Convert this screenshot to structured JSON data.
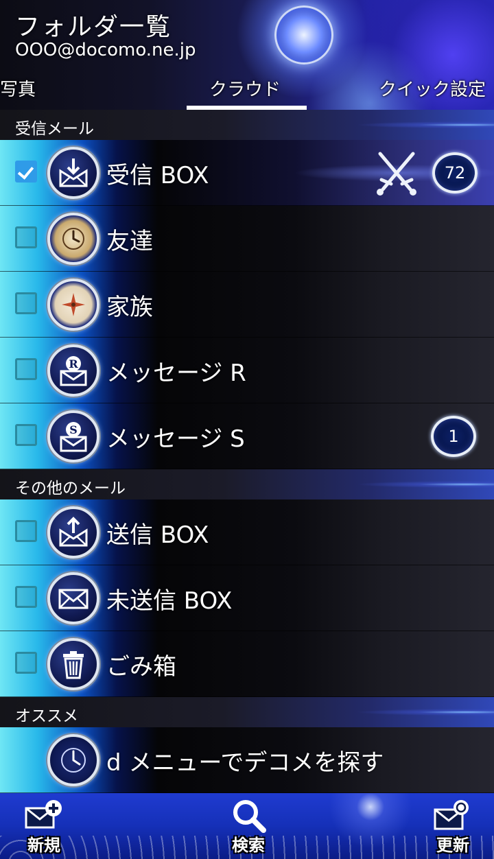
{
  "header": {
    "title": "フォルダ一覧",
    "account": "OOO@docomo.ne.jp"
  },
  "tabs": [
    {
      "label": "写真",
      "selected": false
    },
    {
      "label": "クラウド",
      "selected": true
    },
    {
      "label": "クイック設定",
      "selected": false
    }
  ],
  "sections": {
    "inbox_group": "受信メール",
    "other_group": "その他のメール",
    "recommend_group": "オススメ"
  },
  "folders": [
    {
      "label": "受信 BOX",
      "icon": "mail-download-icon",
      "checked": true,
      "badge": "72",
      "highlight": true
    },
    {
      "label": "友達",
      "icon": "clock-icon",
      "checked": false
    },
    {
      "label": "家族",
      "icon": "compass-icon",
      "checked": false
    },
    {
      "label": "メッセージ R",
      "icon": "mail-r-icon",
      "checked": false
    },
    {
      "label": "メッセージ S",
      "icon": "mail-s-icon",
      "checked": false,
      "badge": "1"
    },
    {
      "label": "送信 BOX",
      "icon": "mail-upload-icon",
      "checked": false
    },
    {
      "label": "未送信 BOX",
      "icon": "mail-icon",
      "checked": false
    },
    {
      "label": "ごみ箱",
      "icon": "trash-icon",
      "checked": false
    }
  ],
  "recommend": {
    "label": "d メニューでデコメを探す",
    "icon": "clock-icon"
  },
  "bottom_bar": {
    "new_label": "新規",
    "search_label": "検索",
    "refresh_label": "更新"
  },
  "colors": {
    "accent": "#2f9be8",
    "bar": "#1f3bd0"
  }
}
